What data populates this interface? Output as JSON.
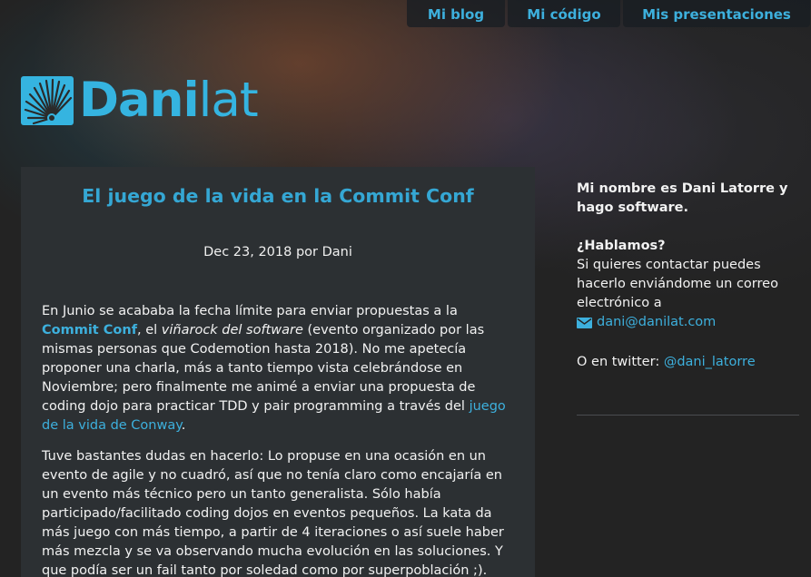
{
  "nav": {
    "items": [
      {
        "label": "Mi blog"
      },
      {
        "label": "Mi código"
      },
      {
        "label": "Mis presentaciones"
      }
    ]
  },
  "logo": {
    "text_bold": "Dani",
    "text_light": "lat",
    "icon": "fan-logo-icon",
    "color": "#35b4e0"
  },
  "post": {
    "title": "El juego de la vida en la Commit Conf",
    "meta": "Dec 23, 2018 por Dani",
    "p1": {
      "t1": "En Junio se acababa la fecha límite para enviar propuestas a la ",
      "link1": "Commit Conf",
      "t2": ", el ",
      "em": "viñarock del software",
      "t3": " (evento organizado por las mismas personas que Codemotion hasta 2018). No me apetecía proponer una charla, más a tanto tiempo vista celebrándose en Noviembre; pero finalmente me animé a enviar una propuesta de coding dojo para practicar TDD y pair programming a través del ",
      "link2": "juego de la vida de Conway",
      "t4": "."
    },
    "p2": "Tuve bastantes dudas en hacerlo: Lo propuse en una ocasión en un evento de agile y no cuadró, así que no tenía claro como encajaría en un evento más técnico pero un tanto generalista. Sólo había participado/facilitado coding dojos en eventos pequeños. La kata da más juego con más tiempo, a partir de 4 iteraciones o así suele haber más mezcla y se va observando mucha evolución en las soluciones. Y que podía ser un fail tanto por soledad como por superpoblación ;)."
  },
  "sidebar": {
    "intro": "Mi nombre es Dani Latorre y hago software.",
    "talk_title": "¿Hablamos?",
    "talk_text": "Si quieres contactar puedes hacerlo enviándome un correo electrónico a",
    "email": "dani@danilat.com",
    "email_icon": "envelope-icon",
    "twitter_prefix": "O en twitter: ",
    "twitter_handle": "@dani_latorre"
  },
  "colors": {
    "accent": "#3db0dd",
    "article_bg": "#2c3033",
    "page_bg": "#232323"
  }
}
